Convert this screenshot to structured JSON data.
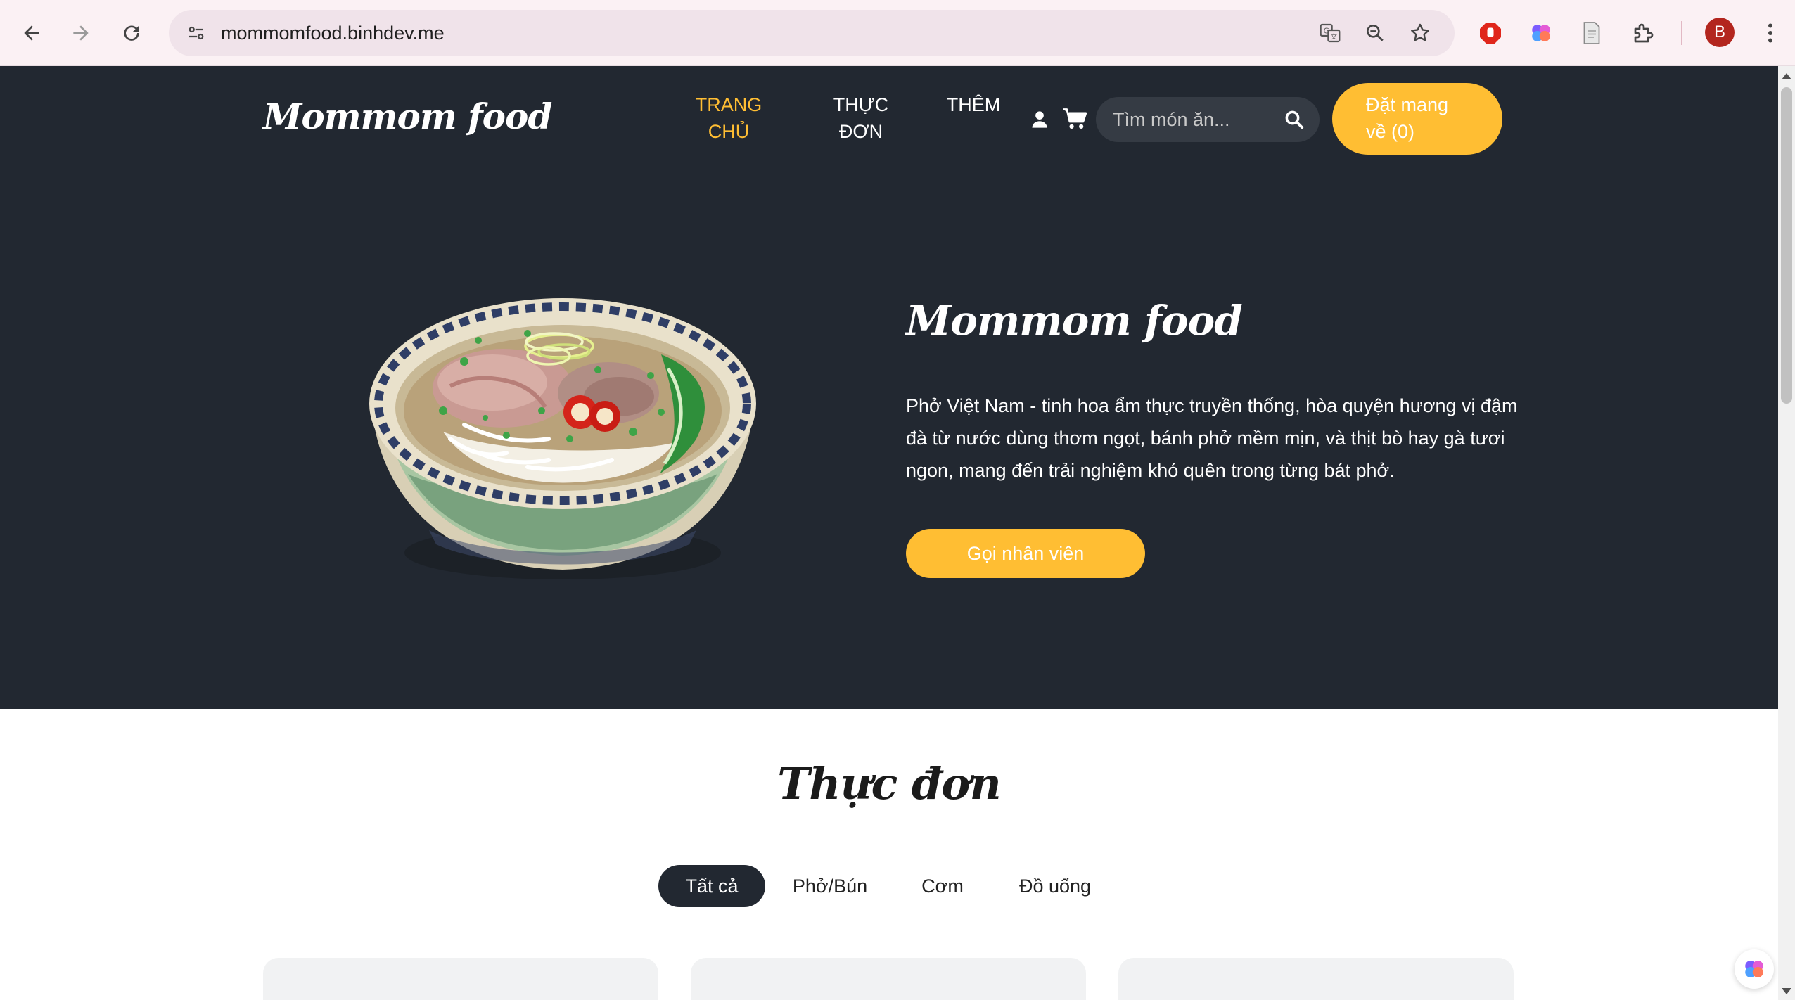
{
  "browser": {
    "url": "mommomfood.binhdev.me",
    "profile_initial": "B",
    "icons": [
      "back-icon",
      "forward-icon",
      "reload-icon",
      "site-info-icon",
      "translate-icon",
      "zoom-icon",
      "bookmark-star-icon",
      "adblock-icon",
      "brain-extension-icon",
      "document-extension-icon",
      "extensions-puzzle-icon",
      "kebab-menu-icon"
    ]
  },
  "header": {
    "logo": "Mommom food",
    "nav": [
      {
        "line1": "TRANG",
        "line2": "CHỦ",
        "active": true
      },
      {
        "line1": "THỰC",
        "line2": "ĐƠN",
        "active": false
      },
      {
        "line1": "THÊM",
        "line2": "",
        "active": false
      }
    ],
    "search_placeholder": "Tìm món ăn...",
    "order_button_line1": "Đặt mang",
    "order_button_line2": "về (0)"
  },
  "hero": {
    "title": "Mommom food",
    "description": "Phở Việt Nam - tinh hoa ẩm thực truyền thống, hòa quyện hương vị đậm đà từ nước dùng thơm ngọt, bánh phở mềm mịn, và thịt bò hay gà tươi ngon, mang đến trải nghiệm khó quên trong từng bát phở.",
    "cta": "Gọi nhân viên"
  },
  "menu": {
    "title": "Thực đơn",
    "filters": [
      "Tất cả",
      "Phở/Bún",
      "Cơm",
      "Đồ uống"
    ],
    "active_filter": "Tất cả"
  },
  "colors": {
    "accent": "#ffbe33",
    "dark_bg": "#222831",
    "chrome_bg": "#fbf1f4"
  }
}
